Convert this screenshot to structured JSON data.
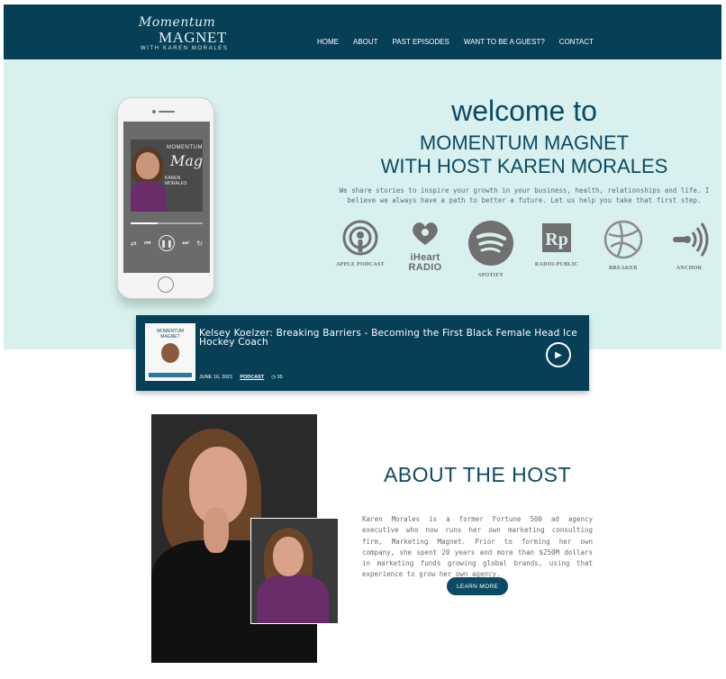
{
  "brand": {
    "script": "Momentum",
    "name": "MAGNET",
    "sub": "WITH KAREN MORALES"
  },
  "nav": [
    "HOME",
    "ABOUT",
    "PAST EPISODES",
    "WANT TO BE A GUEST?",
    "CONTACT"
  ],
  "hero": {
    "welcome": "welcome to",
    "title_line1": "MOMENTUM MAGNET",
    "title_line2": "WITH HOST KAREN MORALES",
    "tagline": "We share stories to inspire your growth in your business, health, relationships and life. I believe we always have a path to better a future. Let us help you take that first step."
  },
  "phone": {
    "art_top": "MOMENTUM",
    "art_script": "Magnet",
    "art_bottom": "KAREN MORALES"
  },
  "platforms": [
    {
      "label": "APPLE PODCAST",
      "icon": "apple-podcast-icon"
    },
    {
      "label": "iHeart RADIO",
      "icon": "iheartradio-icon"
    },
    {
      "label": "SPOTIFY",
      "icon": "spotify-icon"
    },
    {
      "label": "RADIO-PUBLIC",
      "icon": "radiopublic-icon"
    },
    {
      "label": "BREAKER",
      "icon": "breaker-icon"
    },
    {
      "label": "ANCHOR",
      "icon": "anchor-icon"
    }
  ],
  "episode": {
    "thumb_title": "MOMENTUM MAGNET",
    "title": "Kelsey Koelzer: Breaking Barriers - Becoming the First Black Female Head Ice Hockey Coach",
    "date": "JUNE 16, 2021",
    "category": "PODCAST",
    "count": "35"
  },
  "about": {
    "title": "ABOUT THE HOST",
    "text": "Karen Morales is a former Fortune 500 ad agency executive who now runs her own marketing consulting firm, Marketing Magnet. Prior to forming her own company, she spent 20 years and more than $250M dollars in marketing funds growing global brands, using that experience to grow her own agency.",
    "button": "LEARN MORE"
  },
  "colors": {
    "navy": "#073f57",
    "mint": "#d8f1ee",
    "heading": "#0c4a63"
  }
}
